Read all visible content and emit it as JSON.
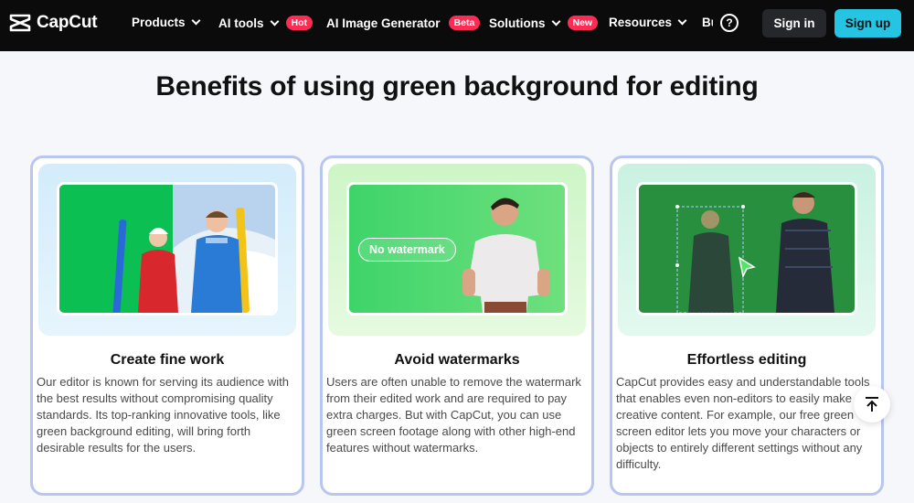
{
  "nav": {
    "logo": "CapCut",
    "items": [
      {
        "label": "Products",
        "badge": ""
      },
      {
        "label": "AI tools",
        "badge": "Hot"
      },
      {
        "label": "AI Image Generator",
        "badge": "Beta"
      },
      {
        "label": "Solutions",
        "badge": "New"
      },
      {
        "label": "Resources",
        "badge": ""
      },
      {
        "label": "Bu",
        "badge": ""
      }
    ],
    "help": "?",
    "signin": "Sign in",
    "signup": "Sign up"
  },
  "section": {
    "heading": "Benefits of using green background for editing"
  },
  "cards": [
    {
      "title": "Create fine work",
      "description": "Our editor is known for serving its audience with the best results without compromising quality standards. Its top-ranking innovative tools, like green background editing, will bring forth desirable results for the users."
    },
    {
      "title": "Avoid watermarks",
      "overlay": "No watermark",
      "description": "Users are often unable to remove the watermark from their edited work and are required to pay extra charges. But with CapCut, you can use green screen footage along with other high-end features without watermarks."
    },
    {
      "title": "Effortless editing",
      "description": "CapCut provides easy and understandable tools that enables even non-editors to easily make creative content. For example, our free green screen editor lets you move your characters or objects to entirely different settings without any difficulty."
    }
  ],
  "colors": {
    "nav_bg": "#0b0b0c",
    "accent": "#25c4e2",
    "badge": "#fe2c55",
    "chroma_green": "#2dbf5a",
    "card_border": "#b9c6ee"
  },
  "icons": {
    "help": "question-circle-icon",
    "scroll_top": "arrow-up-to-top-icon"
  }
}
